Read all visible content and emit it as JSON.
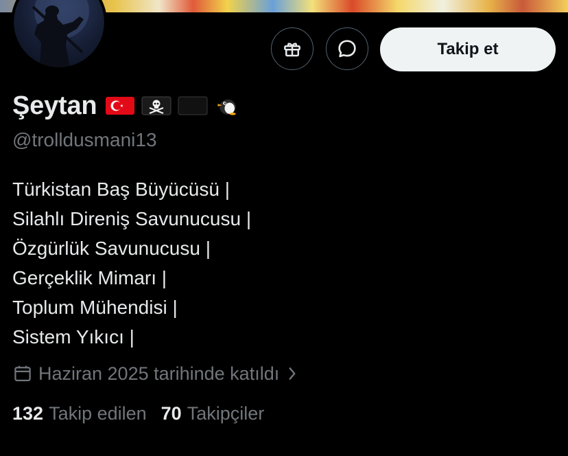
{
  "profile": {
    "display_name": "Şeytan",
    "handle": "@trolldusmani13",
    "name_emojis": [
      "turkey-flag-emoji",
      "pirate-flag-emoji",
      "black-flag-emoji",
      "penguin-emoji"
    ],
    "bio_lines": [
      "Türkistan Baş Büyücüsü |",
      "Silahlı Direniş Savunucusu |",
      "Özgürlük Savunucusu |",
      "Gerçeklik Mimarı |",
      "Toplum Mühendisi |",
      "Sistem Yıkıcı |"
    ],
    "joined_text": "Haziran 2025 tarihinde katıldı"
  },
  "actions": {
    "follow_label": "Takip et",
    "gift_icon": "gift-icon",
    "message_icon": "message-icon"
  },
  "stats": {
    "following_count": "132",
    "following_label": "Takip edilen",
    "followers_count": "70",
    "followers_label": "Takipçiler"
  },
  "colors": {
    "background": "#000000",
    "primary_text": "#e7e9ea",
    "secondary_text": "#71767b",
    "button_bg": "#eff3f4",
    "button_border": "#536471"
  }
}
